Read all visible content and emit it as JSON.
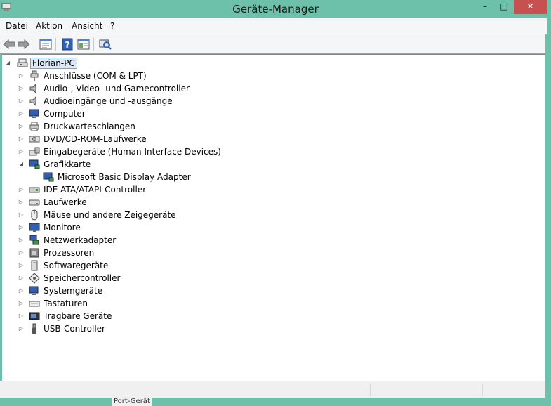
{
  "window": {
    "title": "Geräte-Manager",
    "controls": {
      "minimize": "–",
      "maximize": "□",
      "close": "✕"
    }
  },
  "menu": [
    "Datei",
    "Aktion",
    "Ansicht",
    "?"
  ],
  "toolbar": [
    "back-arrow-icon",
    "forward-arrow-icon",
    "properties-icon",
    "help-icon",
    "view-icon",
    "scan-hardware-icon"
  ],
  "tree": {
    "root": "Florian-PC",
    "items": [
      {
        "label": "Anschlüsse (COM & LPT)",
        "icon": "port-icon",
        "expanded": false
      },
      {
        "label": "Audio-, Video- und Gamecontroller",
        "icon": "speaker-icon",
        "expanded": false
      },
      {
        "label": "Audioeingänge und -ausgänge",
        "icon": "speaker-icon",
        "expanded": false
      },
      {
        "label": "Computer",
        "icon": "computer-icon",
        "expanded": false
      },
      {
        "label": "Druckwarteschlangen",
        "icon": "printer-icon",
        "expanded": false
      },
      {
        "label": "DVD/CD-ROM-Laufwerke",
        "icon": "disc-drive-icon",
        "expanded": false
      },
      {
        "label": "Eingabegeräte (Human Interface Devices)",
        "icon": "hid-icon",
        "expanded": false
      },
      {
        "label": "Grafikkarte",
        "icon": "display-adapter-icon",
        "expanded": true
      },
      {
        "label": "Microsoft Basic Display Adapter",
        "icon": "display-adapter-icon",
        "child": true
      },
      {
        "label": "IDE ATA/ATAPI-Controller",
        "icon": "ide-icon",
        "expanded": false
      },
      {
        "label": "Laufwerke",
        "icon": "drive-icon",
        "expanded": false
      },
      {
        "label": "Mäuse und andere Zeigegeräte",
        "icon": "mouse-icon",
        "expanded": false
      },
      {
        "label": "Monitore",
        "icon": "monitor-icon",
        "expanded": false
      },
      {
        "label": "Netzwerkadapter",
        "icon": "network-icon",
        "expanded": false
      },
      {
        "label": "Prozessoren",
        "icon": "cpu-icon",
        "expanded": false
      },
      {
        "label": "Softwaregeräte",
        "icon": "software-device-icon",
        "expanded": false
      },
      {
        "label": "Speichercontroller",
        "icon": "storage-controller-icon",
        "expanded": false
      },
      {
        "label": "Systemgeräte",
        "icon": "system-device-icon",
        "expanded": false
      },
      {
        "label": "Tastaturen",
        "icon": "keyboard-icon",
        "expanded": false
      },
      {
        "label": "Tragbare Geräte",
        "icon": "portable-device-icon",
        "expanded": false
      },
      {
        "label": "USB-Controller",
        "icon": "usb-icon",
        "expanded": false
      }
    ]
  },
  "taskbar": {
    "partial_text": "Port-Gerät"
  },
  "colors": {
    "titlebar": "#6dc0a9",
    "close": "#c75050",
    "selection": "#dceaf8"
  }
}
